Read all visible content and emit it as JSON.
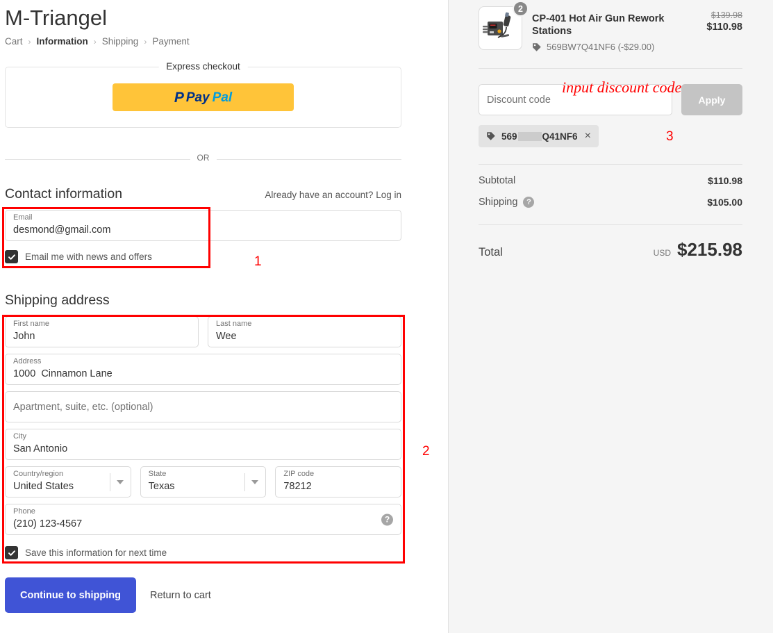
{
  "brand": {
    "name": "M-Triangel"
  },
  "breadcrumb": {
    "items": [
      {
        "label": "Cart",
        "active": false
      },
      {
        "label": "Information",
        "active": true
      },
      {
        "label": "Shipping",
        "active": false
      },
      {
        "label": "Payment",
        "active": false
      }
    ],
    "separator": "›"
  },
  "express": {
    "label": "Express checkout",
    "paypal": {
      "mark": "P",
      "pay": "Pay",
      "pal": "Pal"
    },
    "or": "OR"
  },
  "contact": {
    "title": "Contact information",
    "account_prompt": "Already have an account?",
    "login_link": "Log in",
    "email": {
      "label": "Email",
      "value": "desmond@gmail.com",
      "placeholder": "Email"
    },
    "newsletter_checkbox": {
      "label": "Email me with news and offers",
      "checked": true
    }
  },
  "shipping": {
    "title": "Shipping address",
    "first_name": {
      "label": "First name",
      "value": "John"
    },
    "last_name": {
      "label": "Last name",
      "value": "Wee"
    },
    "address": {
      "label": "Address",
      "value": "1000  Cinnamon Lane"
    },
    "apartment": {
      "label": "",
      "placeholder": "Apartment, suite, etc. (optional)",
      "value": ""
    },
    "city": {
      "label": "City",
      "value": "San Antonio"
    },
    "country": {
      "label": "Country/region",
      "value": "United States"
    },
    "state": {
      "label": "State",
      "value": "Texas"
    },
    "zip": {
      "label": "ZIP code",
      "value": "78212"
    },
    "phone": {
      "label": "Phone",
      "value": "(210) 123-4567",
      "help_icon": "question-mark"
    },
    "save_checkbox": {
      "label": "Save this information for next time",
      "checked": true
    }
  },
  "actions": {
    "continue_label": "Continue to shipping",
    "return_label": "Return to cart",
    "primary_color": "#4054d6"
  },
  "summary": {
    "item": {
      "name": "CP-401 Hot Air Gun Rework Stations",
      "quantity": "2",
      "discount_code": "569BW7Q41NF6 (-$29.00)",
      "price_original": "$139.98",
      "price_final": "$110.98"
    },
    "discount": {
      "placeholder": "Discount code",
      "apply_label": "Apply",
      "chip_prefix": "569",
      "chip_suffix": "Q41NF6",
      "chip_remove": "×"
    },
    "rows": [
      {
        "label": "Subtotal",
        "value": "$110.98",
        "has_help": false
      },
      {
        "label": "Shipping",
        "value": "$105.00",
        "has_help": true
      }
    ],
    "total": {
      "label": "Total",
      "currency": "USD",
      "value": "$215.98"
    }
  },
  "annotations": {
    "one": "1",
    "two": "2",
    "three": "3",
    "discount_hint": "input discount code",
    "color": "#ff0000"
  }
}
